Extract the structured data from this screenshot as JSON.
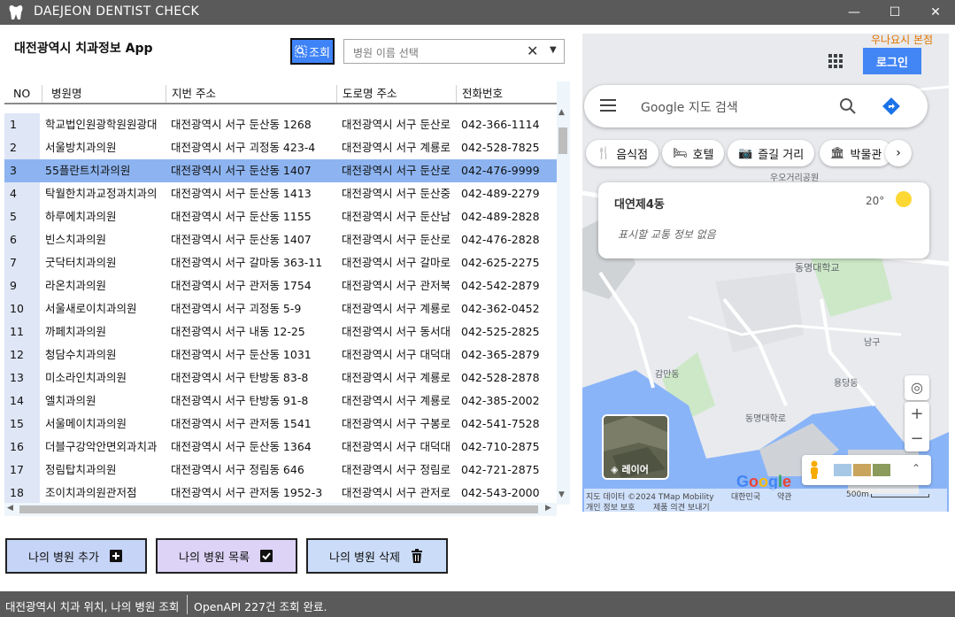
{
  "window": {
    "title": "DAEJEON DENTIST CHECK",
    "minimize": "—",
    "maximize": "☐",
    "close": "✕"
  },
  "header": {
    "app_title": "대전광역시 치과정보 App",
    "query_button": "조회",
    "combo_placeholder": "병원 이름 선택"
  },
  "table": {
    "columns": [
      "NO",
      "병원명",
      "지번 주소",
      "도로명 주소",
      "전화번호"
    ],
    "rows": [
      {
        "no": "1",
        "name": "학교법인원광학원원광대",
        "jibun": "대전광역시 서구 둔산동 1268",
        "road": "대전광역시 서구 둔산로",
        "phone": "042-366-1114"
      },
      {
        "no": "2",
        "name": "서울방치과의원",
        "jibun": "대전광역시 서구 괴정동 423-4",
        "road": "대전광역시 서구 계룡로",
        "phone": "042-528-7825"
      },
      {
        "no": "3",
        "name": "55플란트치과의원",
        "jibun": "대전광역시 서구 둔산동 1407",
        "road": "대전광역시 서구 둔산로",
        "phone": "042-476-9999"
      },
      {
        "no": "4",
        "name": "탁월한치과교정과치과의",
        "jibun": "대전광역시 서구 둔산동 1413",
        "road": "대전광역시 서구 둔산중",
        "phone": "042-489-2279"
      },
      {
        "no": "5",
        "name": "하루에치과의원",
        "jibun": "대전광역시 서구 둔산동 1155",
        "road": "대전광역시 서구 둔산남",
        "phone": "042-489-2828"
      },
      {
        "no": "6",
        "name": "빈스치과의원",
        "jibun": "대전광역시 서구 둔산동 1407",
        "road": "대전광역시 서구 둔산로",
        "phone": "042-476-2828"
      },
      {
        "no": "7",
        "name": "굿닥터치과의원",
        "jibun": "대전광역시 서구 갈마동 363-11",
        "road": "대전광역시 서구 갈마로",
        "phone": "042-625-2275"
      },
      {
        "no": "9",
        "name": "라온치과의원",
        "jibun": "대전광역시 서구 관저동 1754",
        "road": "대전광역시 서구 관저북",
        "phone": "042-542-2879"
      },
      {
        "no": "10",
        "name": "서울새로이치과의원",
        "jibun": "대전광역시 서구 괴정동 5-9",
        "road": "대전광역시 서구 계룡로",
        "phone": "042-362-0452"
      },
      {
        "no": "11",
        "name": "까페치과의원",
        "jibun": "대전광역시 서구 내동 12-25",
        "road": "대전광역시 서구 동서대",
        "phone": "042-525-2825"
      },
      {
        "no": "12",
        "name": "청담수치과의원",
        "jibun": "대전광역시 서구 둔산동 1031",
        "road": "대전광역시 서구 대덕대",
        "phone": "042-365-2879"
      },
      {
        "no": "13",
        "name": "미소라인치과의원",
        "jibun": "대전광역시 서구 탄방동 83-8",
        "road": "대전광역시 서구 계룡로",
        "phone": "042-528-2878"
      },
      {
        "no": "14",
        "name": "엘치과의원",
        "jibun": "대전광역시 서구 탄방동 91-8",
        "road": "대전광역시 서구 계룡로",
        "phone": "042-385-2002"
      },
      {
        "no": "15",
        "name": "서울메이치과의원",
        "jibun": "대전광역시 서구 관저동 1541",
        "road": "대전광역시 서구 구봉로",
        "phone": "042-541-7528"
      },
      {
        "no": "16",
        "name": "더블구강악안면외과치과",
        "jibun": "대전광역시 서구 둔산동 1364",
        "road": "대전광역시 서구 대덕대",
        "phone": "042-710-2875"
      },
      {
        "no": "17",
        "name": "정림탑치과의원",
        "jibun": "대전광역시 서구 정림동 646",
        "road": "대전광역시 서구 정림로",
        "phone": "042-721-2875"
      },
      {
        "no": "18",
        "name": "조이치과의원관저점",
        "jibun": "대전광역시 서구 관저동 1952-3",
        "road": "대전광역시 서구 관저로",
        "phone": "042-543-2000"
      }
    ],
    "selected_row_no": "3"
  },
  "actions": {
    "add": "나의 병원 추가",
    "list": "나의 병원 목록",
    "delete": "나의 병원 삭제"
  },
  "status": {
    "left": "대전광역시 치과 위치, 나의 병원 조회",
    "right": "OpenAPI 227건 조회 완료."
  },
  "map": {
    "corner_place": "우나요시 본점",
    "login": "로그인",
    "search_placeholder": "Google 지도 검색",
    "chips": [
      "음식점",
      "호텔",
      "즐길 거리",
      "박물관"
    ],
    "weather_location": "대연제4동",
    "weather_temp": "20°",
    "traffic_text": "표시할 교통 정보 없음",
    "layer_label": "레이어",
    "place_labels": [
      "동명대학교",
      "남구",
      "용당동",
      "감만동",
      "우오거리공원",
      "동명대학로"
    ],
    "google_logo": "Google",
    "attribution": "지도 데이터 ©2024 TMap Mobility",
    "country": "대한민국",
    "terms": "약관",
    "privacy": "개인 정보 보호",
    "feedback": "제품 의견 보내기",
    "scale": "500m",
    "colors": {
      "water": "#8ab4f8",
      "land": "#e8eaed",
      "park": "#cde8c7",
      "road": "#ffffff",
      "accent": "#4285f4"
    }
  },
  "colors": {
    "titlebar": "#5a5a5a",
    "selected_row": "#8db4f0",
    "add_button": "#c6d4f7",
    "list_button": "#dcd3f7",
    "delete_button": "#cbdcf8",
    "query_button": "#3f83f8"
  }
}
